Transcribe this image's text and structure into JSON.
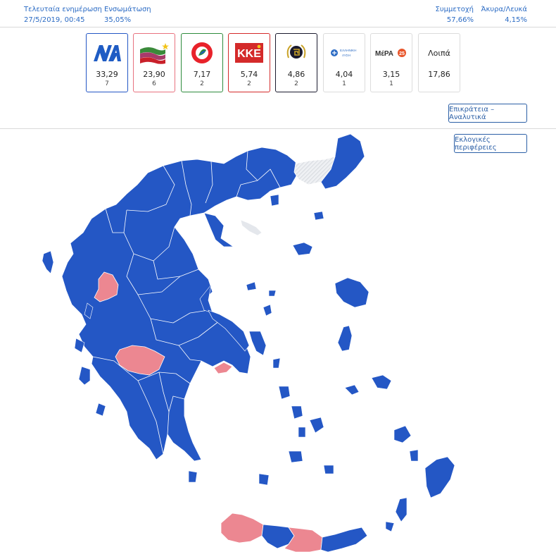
{
  "header": {
    "last_update_label": "Τελευταία ενημέρωση",
    "last_update_value": "27/5/2019, 00:45",
    "counted_label": "Ενσωμάτωση",
    "counted_value": "35,05%",
    "turnout_label": "Συμμετοχή",
    "turnout_value": "57,66%",
    "invalid_label": "Άκυρα/Λευκά",
    "invalid_value": "4,15%"
  },
  "parties": [
    {
      "name": "ΝΔ",
      "logo_text": "ΝΔ",
      "pct": "33,29",
      "seats": "7",
      "color": "#1f5cc4"
    },
    {
      "name": "ΣΥΡΙΖΑ",
      "logo_text": "",
      "pct": "23,90",
      "seats": "6",
      "color": "#e8727f"
    },
    {
      "name": "ΚΙΝΑΛ",
      "logo_text": "",
      "pct": "7,17",
      "seats": "2",
      "color": "#2e8b3c"
    },
    {
      "name": "ΚΚΕ",
      "logo_text": "ΚΚΕ",
      "pct": "5,74",
      "seats": "2",
      "color": "#d42a2a"
    },
    {
      "name": "ΧΑ",
      "logo_text": "",
      "pct": "4,86",
      "seats": "2",
      "color": "#1a1a2e"
    },
    {
      "name": "ΕΛ",
      "logo_text": "ΕΛΛΗΝΙΚΗ ΛΥΣΗ",
      "pct": "4,04",
      "seats": "1",
      "color": "#cfcfcf"
    },
    {
      "name": "ΜέΡΑ25",
      "logo_text": "ΜέΡΑ25",
      "pct": "3,15",
      "seats": "1",
      "color": "#cfcfcf"
    },
    {
      "name": "Λοιπά",
      "logo_text": "Λοιπά",
      "pct": "17,86",
      "seats": "",
      "color": "#cfcfcf"
    }
  ],
  "buttons": {
    "analytics": "Επικράτεια – Αναλυτικά",
    "regions": "Εκλογικές περιφέρειες"
  },
  "colors": {
    "nd": "#2457c5",
    "syriza": "#ec8791",
    "pending": "#e4e7ec"
  }
}
